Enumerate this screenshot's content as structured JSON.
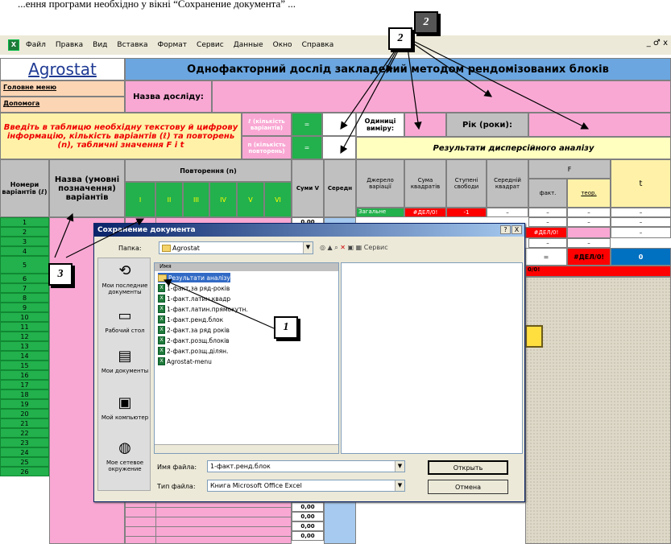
{
  "top_text": "...ення програми необхідно у вікні “Сохранение документа” ...",
  "menu": [
    "Файл",
    "Правка",
    "Вид",
    "Вставка",
    "Формат",
    "Сервис",
    "Данные",
    "Окно",
    "Справка"
  ],
  "window_controls": "_ ♂ x",
  "app_title": "Agrostat",
  "main_title": "Однофакторний дослід закладений методом рендомізованих блоків",
  "main_menu": "Головне меню",
  "help": "Допомога",
  "study_name_label": "Назва досліду:",
  "instruction": "Введіть в таблицю необхідну текстову й цифрову інформацію, кількість варіантів (ℓ) та повторень (n), табличні значення F i t",
  "l_label": "ℓ (кількість варіантів)",
  "n_label": "n (кількість повторень)",
  "eq": "=",
  "units_label": "Одиниці виміру:",
  "year_label": "Рік (роки):",
  "results_label": "Результати дисперсійного аналізу",
  "col_num": "Номери варіантів (ℓ)",
  "col_name": "Назва (умовні позначення) варіантів",
  "col_reps": "Повторення (n)",
  "reps": [
    "І",
    "ІІ",
    "ІІІ",
    "IV",
    "V",
    "VI"
  ],
  "col_sumV": "Суми V",
  "col_mean": "Середн",
  "anova_cols": [
    "Джерело варіації",
    "Сума квадратів",
    "Ступені свободи",
    "Середній квадрат",
    "F",
    "t"
  ],
  "f_sub": [
    "факт.",
    "теор."
  ],
  "anova_row1": [
    "Загальне",
    "#ДЕЛ/0!",
    "-1",
    "–",
    "–",
    "–",
    "–"
  ],
  "err_div": "#ДЕЛ/0!",
  "dash": "–",
  "zero": "0",
  "row_numbers": [
    "1",
    "2",
    "3",
    "4",
    "5",
    "6",
    "7",
    "8",
    "9",
    "10",
    "11",
    "12",
    "13",
    "14",
    "15",
    "16",
    "17",
    "18",
    "19",
    "20",
    "21",
    "22",
    "23",
    "24",
    "25",
    "26"
  ],
  "sum_values": [
    "0,00",
    "0,00",
    "0,00",
    "0,00"
  ],
  "sum_top": "0,00",
  "partial_err": "0/0!",
  "dialog": {
    "title": "Сохранение документа",
    "help_btn": "?",
    "close_btn": "X",
    "folder_label": "Папка:",
    "folder_value": "Agrostat",
    "tools": "Сервис",
    "list_header": "Имя",
    "files": [
      "Результати аналізу",
      "1-факт.за ряд-років",
      "1-факт.латин.квадр",
      "1-факт.латин.прямокутн.",
      "1-факт.ренд.блок",
      "2-факт.за ряд років",
      "2-факт.розщ.блоків",
      "2-факт.розщ.ділян.",
      "Agrostat-menu"
    ],
    "places": [
      "Мои последние документы",
      "Рабочий стол",
      "Мои документы",
      "Мой компьютер",
      "Мое сетевое окружение"
    ],
    "filename_label": "Имя файла:",
    "filename_value": "1-факт.ренд.блок",
    "filetype_label": "Тип файла:",
    "filetype_value": "Книга Microsoft Office Excel",
    "open_btn": "Открыть",
    "cancel_btn": "Отмена"
  },
  "callouts": [
    "1",
    "2",
    "3"
  ],
  "colors": {
    "pink": "#f9a8d4",
    "green": "#22b14c",
    "blue": "#6ba6e0",
    "red": "#ff0000",
    "yellow": "#fff2a8"
  }
}
